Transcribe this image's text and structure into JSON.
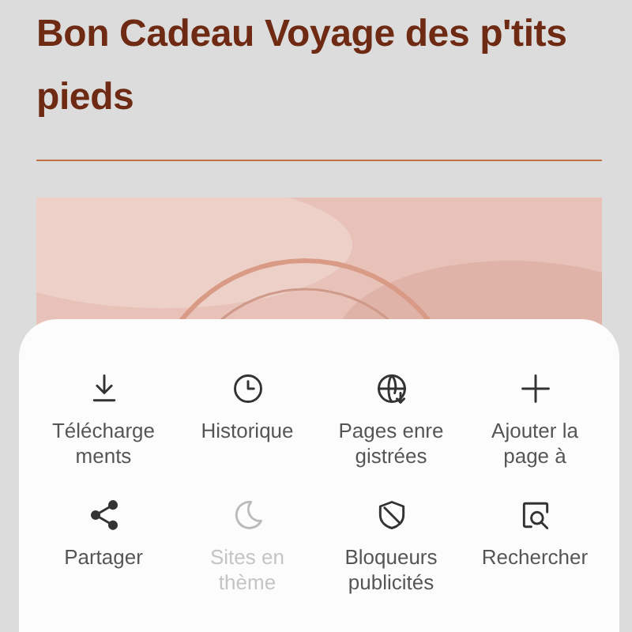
{
  "page": {
    "title": "Bon Cadeau Voyage des p'tits pieds"
  },
  "menu": {
    "items": [
      {
        "kind": "download",
        "lines": [
          "Télécharge",
          "ments"
        ],
        "disabled": false
      },
      {
        "kind": "clock",
        "lines": [
          "Historique"
        ],
        "disabled": false
      },
      {
        "kind": "globe",
        "lines": [
          "Pages enre",
          "gistrées"
        ],
        "disabled": false
      },
      {
        "kind": "plus",
        "lines": [
          "Ajouter la",
          "page à"
        ],
        "disabled": false
      },
      {
        "kind": "share",
        "lines": [
          "Partager"
        ],
        "disabled": false
      },
      {
        "kind": "moon",
        "lines": [
          "Sites en",
          "thème"
        ],
        "disabled": true
      },
      {
        "kind": "shield",
        "lines": [
          "Bloqueurs",
          "publicités"
        ],
        "disabled": false
      },
      {
        "kind": "search",
        "lines": [
          "Rechercher"
        ],
        "disabled": false
      }
    ]
  }
}
